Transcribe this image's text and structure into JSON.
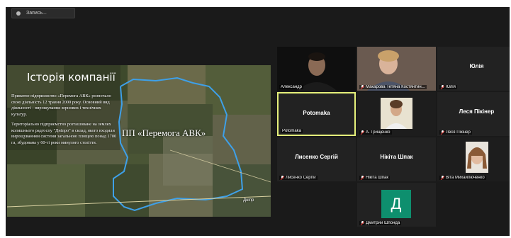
{
  "recording": {
    "label": "Запись..."
  },
  "slide": {
    "title": "Історія компанії",
    "paragraph1": "Приватне підприємство «Перемога АВК» розпочало свою діяльність 12 травня 2000 року. Основний вид діяльності - вирощування зернових і технічних культур.",
    "paragraph2": "Територіально підприємство розташоване на землях колишнього радгоспу \"Дніпро\" в склад, якого входили вирощуванням системи загальною площею понад 1700 га, збудована у 60-ті роки минулого століття.",
    "company_label": "ПП «Перемога АВК»",
    "map_town": "Дніпр"
  },
  "participants": [
    {
      "name": "Александр",
      "display": "",
      "video": true,
      "muted": false
    },
    {
      "name": "Макарова Тетяна Костянтин...",
      "display": "",
      "video": true,
      "muted": true
    },
    {
      "name": "Юлія",
      "display": "Юлія",
      "video": false,
      "muted": true
    },
    {
      "name": "Potomaka",
      "display": "Potomaka",
      "video": false,
      "muted": false,
      "active": true
    },
    {
      "name": "А. Грищенко",
      "display": "",
      "video": true,
      "muted": true
    },
    {
      "name": "Леся Пікінер",
      "display": "Леся Пікінер",
      "video": false,
      "muted": true
    },
    {
      "name": "Лисенко Сергій",
      "display": "Лисенко Сергій",
      "video": false,
      "muted": true
    },
    {
      "name": "Нікіта Шпак",
      "display": "Нікіта Шпак",
      "video": false,
      "muted": true
    },
    {
      "name": "Віта Михайлюченко",
      "display": "",
      "video": true,
      "muted": true
    },
    {
      "name": "Дмитрий Шпонда",
      "display": "",
      "video": false,
      "muted": true,
      "avatar_letter": "Д",
      "avatar_color": "#0e8f6e"
    }
  ]
}
